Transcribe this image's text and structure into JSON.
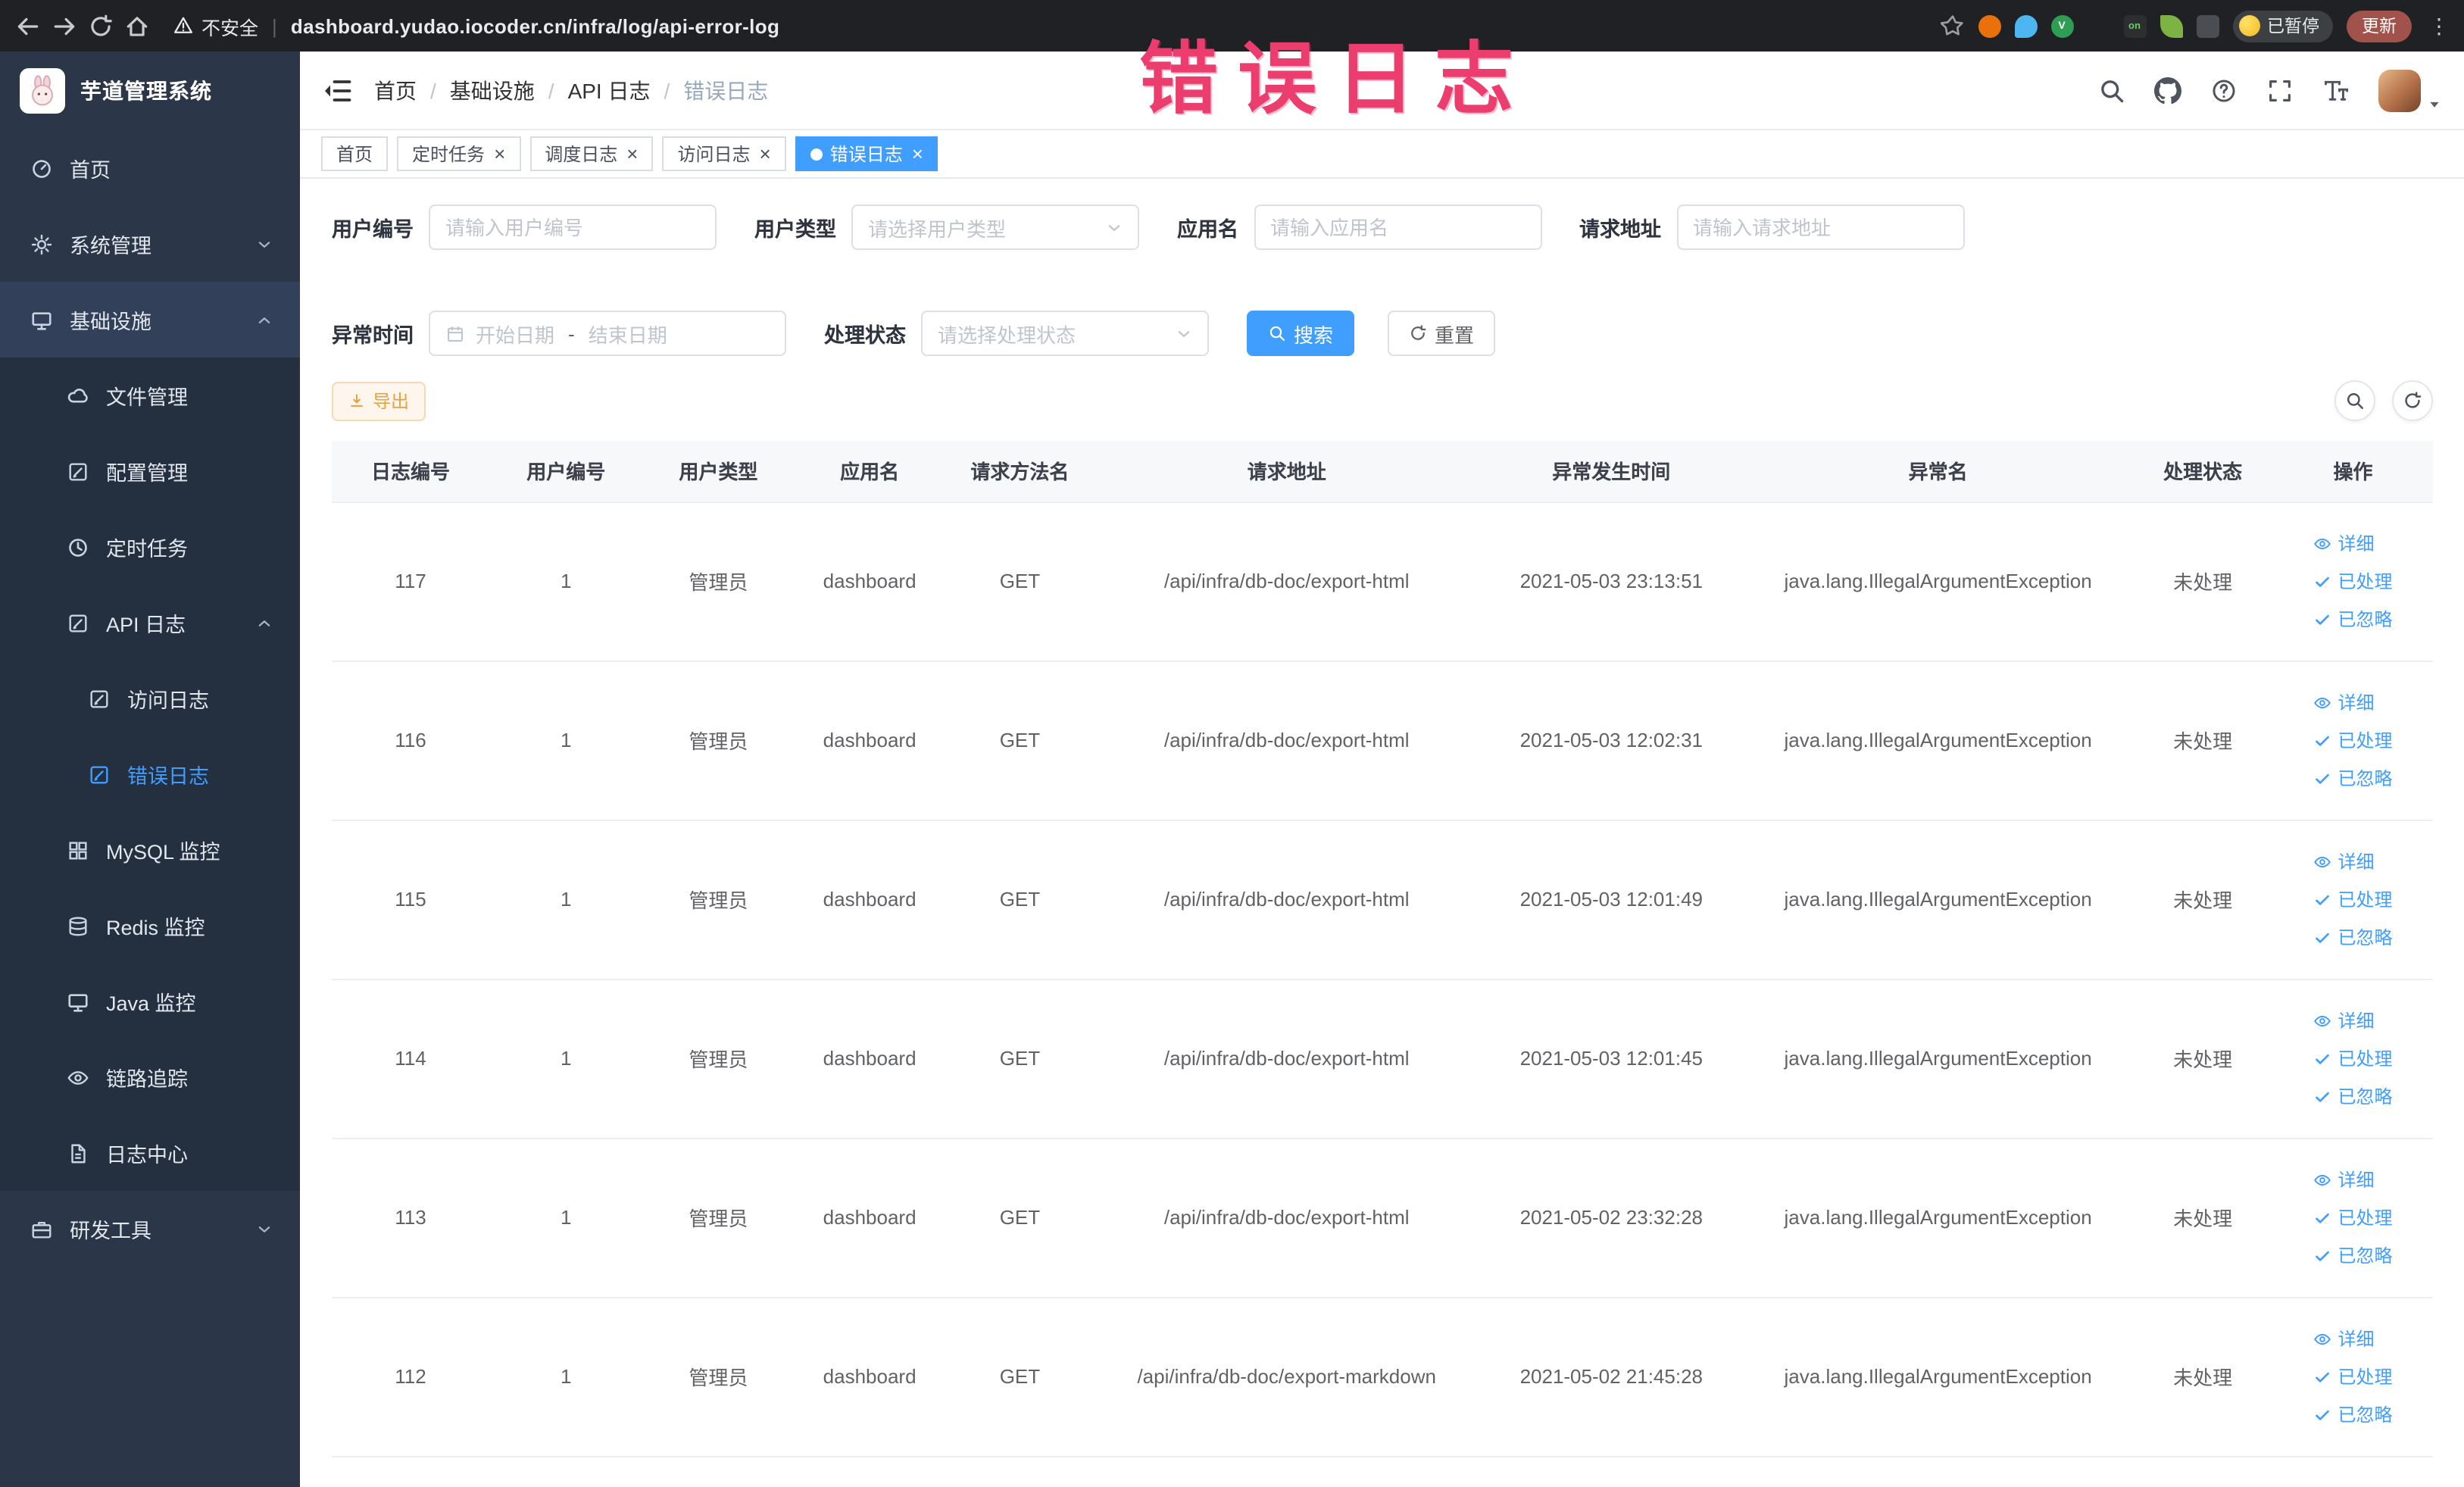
{
  "browser": {
    "security_label": "不安全",
    "url": "dashboard.yudao.iocoder.cn/infra/log/api-error-log",
    "paused_label": "已暂停",
    "update_label": "更新",
    "extension_icons": [
      "ext-orange-icon",
      "ext-drop-icon",
      "ext-green-icon",
      "ext-grid-icon",
      "ext-on-icon",
      "ext-leaf-icon",
      "ext-puzzle-icon"
    ],
    "ext_on_text": "on",
    "ext_green_text": "V"
  },
  "annotation": {
    "text": "错误日志",
    "color": "#eb3d6e"
  },
  "sidebar": {
    "app_title": "芋道管理系统",
    "items": [
      {
        "label": "首页",
        "icon": "dashboard-icon",
        "level": 1
      },
      {
        "label": "系统管理",
        "icon": "gear-icon",
        "level": 1,
        "chevron": "down"
      },
      {
        "label": "基础设施",
        "icon": "monitor-icon",
        "level": 1,
        "chevron": "up",
        "highlight": true
      },
      {
        "label": "文件管理",
        "icon": "cloud-icon",
        "level": 2
      },
      {
        "label": "配置管理",
        "icon": "edit-icon",
        "level": 2
      },
      {
        "label": "定时任务",
        "icon": "clock-icon",
        "level": 2
      },
      {
        "label": "API 日志",
        "icon": "edit-icon",
        "level": 2,
        "chevron": "up"
      },
      {
        "label": "访问日志",
        "icon": "edit-icon",
        "level": 3
      },
      {
        "label": "错误日志",
        "icon": "edit-icon",
        "level": 3,
        "active": true
      },
      {
        "label": "MySQL 监控",
        "icon": "grid-icon",
        "level": 2
      },
      {
        "label": "Redis 监控",
        "icon": "db-icon",
        "level": 2
      },
      {
        "label": "Java 监控",
        "icon": "monitor-icon",
        "level": 2
      },
      {
        "label": "链路追踪",
        "icon": "eye-icon",
        "level": 2
      },
      {
        "label": "日志中心",
        "icon": "doc-icon",
        "level": 2
      },
      {
        "label": "研发工具",
        "icon": "briefcase-icon",
        "level": 1,
        "chevron": "down"
      }
    ]
  },
  "breadcrumb": [
    "首页",
    "基础设施",
    "API 日志",
    "错误日志"
  ],
  "tabs": [
    {
      "label": "首页",
      "closable": false,
      "active": false
    },
    {
      "label": "定时任务",
      "closable": true,
      "active": false
    },
    {
      "label": "调度日志",
      "closable": true,
      "active": false
    },
    {
      "label": "访问日志",
      "closable": true,
      "active": false
    },
    {
      "label": "错误日志",
      "closable": true,
      "active": true
    }
  ],
  "filters": {
    "user_id_label": "用户编号",
    "user_id_placeholder": "请输入用户编号",
    "user_type_label": "用户类型",
    "user_type_placeholder": "请选择用户类型",
    "app_name_label": "应用名",
    "app_name_placeholder": "请输入应用名",
    "request_url_label": "请求地址",
    "request_url_placeholder": "请输入请求地址",
    "exception_time_label": "异常时间",
    "start_date_placeholder": "开始日期",
    "date_separator": "-",
    "end_date_placeholder": "结束日期",
    "process_status_label": "处理状态",
    "process_status_placeholder": "请选择处理状态",
    "search_button": "搜索",
    "reset_button": "重置"
  },
  "toolbar": {
    "export_button": "导出"
  },
  "table": {
    "headers": [
      "日志编号",
      "用户编号",
      "用户类型",
      "应用名",
      "请求方法名",
      "请求地址",
      "异常发生时间",
      "异常名",
      "处理状态",
      "操作"
    ],
    "action_labels": {
      "detail": "详细",
      "processed": "已处理",
      "ignored": "已忽略"
    },
    "rows": [
      {
        "log_id": "117",
        "user_id": "1",
        "user_type": "管理员",
        "app_name": "dashboard",
        "method": "GET",
        "url": "/api/infra/db-doc/export-html",
        "time": "2021-05-03 23:13:51",
        "exception": "java.lang.IllegalArgumentException",
        "status": "未处理"
      },
      {
        "log_id": "116",
        "user_id": "1",
        "user_type": "管理员",
        "app_name": "dashboard",
        "method": "GET",
        "url": "/api/infra/db-doc/export-html",
        "time": "2021-05-03 12:02:31",
        "exception": "java.lang.IllegalArgumentException",
        "status": "未处理"
      },
      {
        "log_id": "115",
        "user_id": "1",
        "user_type": "管理员",
        "app_name": "dashboard",
        "method": "GET",
        "url": "/api/infra/db-doc/export-html",
        "time": "2021-05-03 12:01:49",
        "exception": "java.lang.IllegalArgumentException",
        "status": "未处理"
      },
      {
        "log_id": "114",
        "user_id": "1",
        "user_type": "管理员",
        "app_name": "dashboard",
        "method": "GET",
        "url": "/api/infra/db-doc/export-html",
        "time": "2021-05-03 12:01:45",
        "exception": "java.lang.IllegalArgumentException",
        "status": "未处理"
      },
      {
        "log_id": "113",
        "user_id": "1",
        "user_type": "管理员",
        "app_name": "dashboard",
        "method": "GET",
        "url": "/api/infra/db-doc/export-html",
        "time": "2021-05-02 23:32:28",
        "exception": "java.lang.IllegalArgumentException",
        "status": "未处理"
      },
      {
        "log_id": "112",
        "user_id": "1",
        "user_type": "管理员",
        "app_name": "dashboard",
        "method": "GET",
        "url": "/api/infra/db-doc/export-markdown",
        "time": "2021-05-02 21:45:28",
        "exception": "java.lang.IllegalArgumentException",
        "status": "未处理"
      }
    ]
  },
  "colors": {
    "accent": "#409eff",
    "sidebar_bg": "#2b3648",
    "submenu_bg": "#242f40",
    "annotation": "#eb3d6e",
    "warning": "#e6a23c",
    "active_tab_bg": "#409eff"
  }
}
